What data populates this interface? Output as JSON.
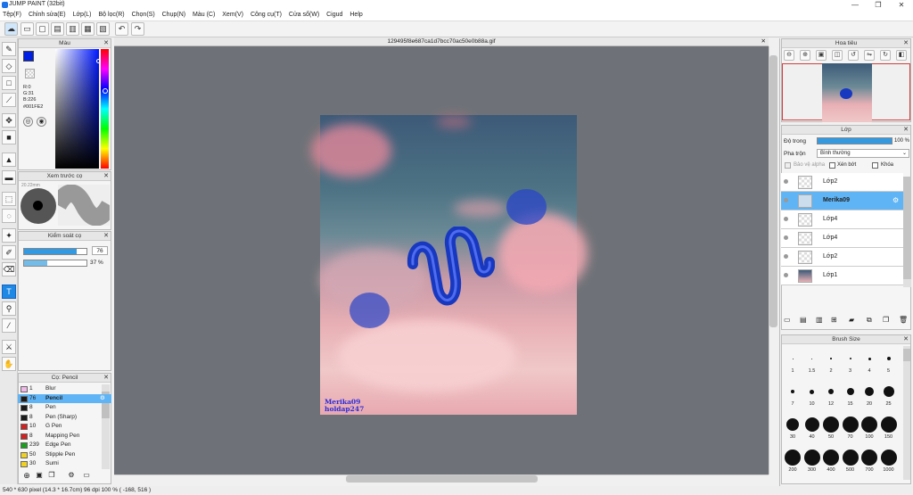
{
  "window": {
    "title": "JUMP PAINT (32bit)",
    "minimize": "—",
    "maximize": "❐",
    "close": "✕"
  },
  "menu": [
    "Tệp(F)",
    "Chỉnh sửa(E)",
    "Lớp(L)",
    "Bộ lọc(R)",
    "Chọn(S)",
    "Chụp(N)",
    "Màu (C)",
    "Xem(V)",
    "Công cụ(T)",
    "Cửa sổ(W)",
    "Cigud",
    "Help"
  ],
  "document": {
    "tab_title": "129495f8e687ca1d7bcc70ac50e0b88a.gif",
    "watermark_line1": "Merika09",
    "watermark_line2": "holdap247"
  },
  "color_panel": {
    "title": "Màu",
    "r": "R:0",
    "g": "G:31",
    "b": "B:226",
    "hex": "#001FE2",
    "fg": "#001FE2"
  },
  "brush_preview": {
    "title": "Xem trước cọ",
    "size": "20.22mm"
  },
  "brush_control": {
    "title": "Kiểm soát cọ",
    "size_value": "76",
    "opacity_value": "37 %"
  },
  "brush_list": {
    "title": "Cọ: Pencil",
    "items": [
      {
        "num": "1",
        "label": "Blur",
        "color": "#f0b8e8"
      },
      {
        "num": "76",
        "label": "Pencil",
        "color": "#1a1a1a"
      },
      {
        "num": "8",
        "label": "Pen",
        "color": "#1a1a1a"
      },
      {
        "num": "8",
        "label": "Pen (Sharp)",
        "color": "#1a1a1a"
      },
      {
        "num": "10",
        "label": "G Pen",
        "color": "#d42020"
      },
      {
        "num": "8",
        "label": "Mapping Pen",
        "color": "#d42020"
      },
      {
        "num": "239",
        "label": "Edge Pen",
        "color": "#1aa01a"
      },
      {
        "num": "50",
        "label": "Stipple Pen",
        "color": "#f0d020"
      },
      {
        "num": "30",
        "label": "Sumi",
        "color": "#f0d020"
      }
    ]
  },
  "navigator": {
    "title": "Hoa tiêu"
  },
  "layers": {
    "title": "Lớp",
    "opacity_label": "Độ trong",
    "opacity_value": "100 %",
    "blend_label": "Pha trộn",
    "blend_value": "Bình thường",
    "protect_alpha": "Bảo vệ alpha",
    "clipping": "Xén bớt",
    "lock": "Khóa",
    "items": [
      "Lớp2",
      "Merika09",
      "Lớp4",
      "Lớp4",
      "Lớp2",
      "Lớp1"
    ]
  },
  "brush_size": {
    "title": "Brush Size",
    "sizes": [
      "1",
      "1.5",
      "2",
      "3",
      "4",
      "5",
      "7",
      "10",
      "12",
      "15",
      "20",
      "25",
      "30",
      "40",
      "50",
      "70",
      "100",
      "150",
      "200",
      "300",
      "400",
      "500",
      "700",
      "1000"
    ]
  },
  "status": {
    "text": "540 * 630 pixel  (14.3 * 16.7cm)  96 dpi  100 %  ( -168, 516 )"
  }
}
